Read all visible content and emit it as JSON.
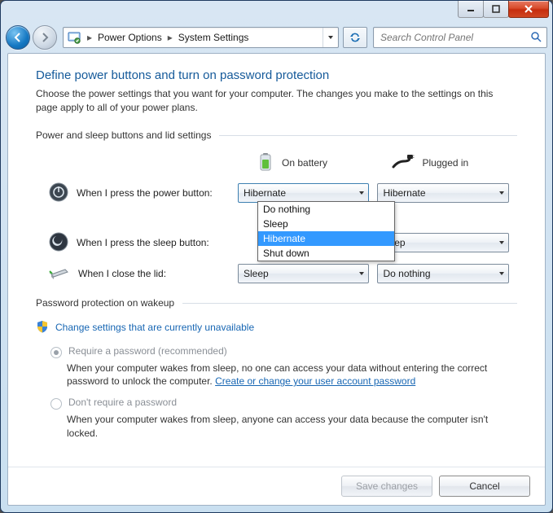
{
  "breadcrumb": {
    "item1": "Power Options",
    "item2": "System Settings"
  },
  "search": {
    "placeholder": "Search Control Panel"
  },
  "heading": "Define power buttons and turn on password protection",
  "description": "Choose the power settings that you want for your computer. The changes you make to the settings on this page apply to all of your power plans.",
  "group_buttons_lid": "Power and sleep buttons and lid settings",
  "columns": {
    "battery": "On battery",
    "plugged": "Plugged in"
  },
  "rows": {
    "power_button": {
      "label": "When I press the power button:",
      "battery": "Hibernate",
      "plugged": "Hibernate"
    },
    "sleep_button": {
      "label": "When I press the sleep button:",
      "plugged": "Sleep"
    },
    "lid": {
      "label": "When I close the lid:",
      "battery": "Sleep",
      "plugged": "Do nothing"
    }
  },
  "dropdown_options": {
    "o0": "Do nothing",
    "o1": "Sleep",
    "o2": "Hibernate",
    "o3": "Shut down"
  },
  "group_password": "Password protection on wakeup",
  "change_settings_link": "Change settings that are currently unavailable",
  "radio_require": {
    "label": "Require a password (recommended)",
    "desc_a": "When your computer wakes from sleep, no one can access your data without entering the correct password to unlock the computer. ",
    "desc_link": "Create or change your user account password"
  },
  "radio_norequire": {
    "label": "Don't require a password",
    "desc": "When your computer wakes from sleep, anyone can access your data because the computer isn't locked."
  },
  "buttons": {
    "save": "Save changes",
    "cancel": "Cancel"
  }
}
